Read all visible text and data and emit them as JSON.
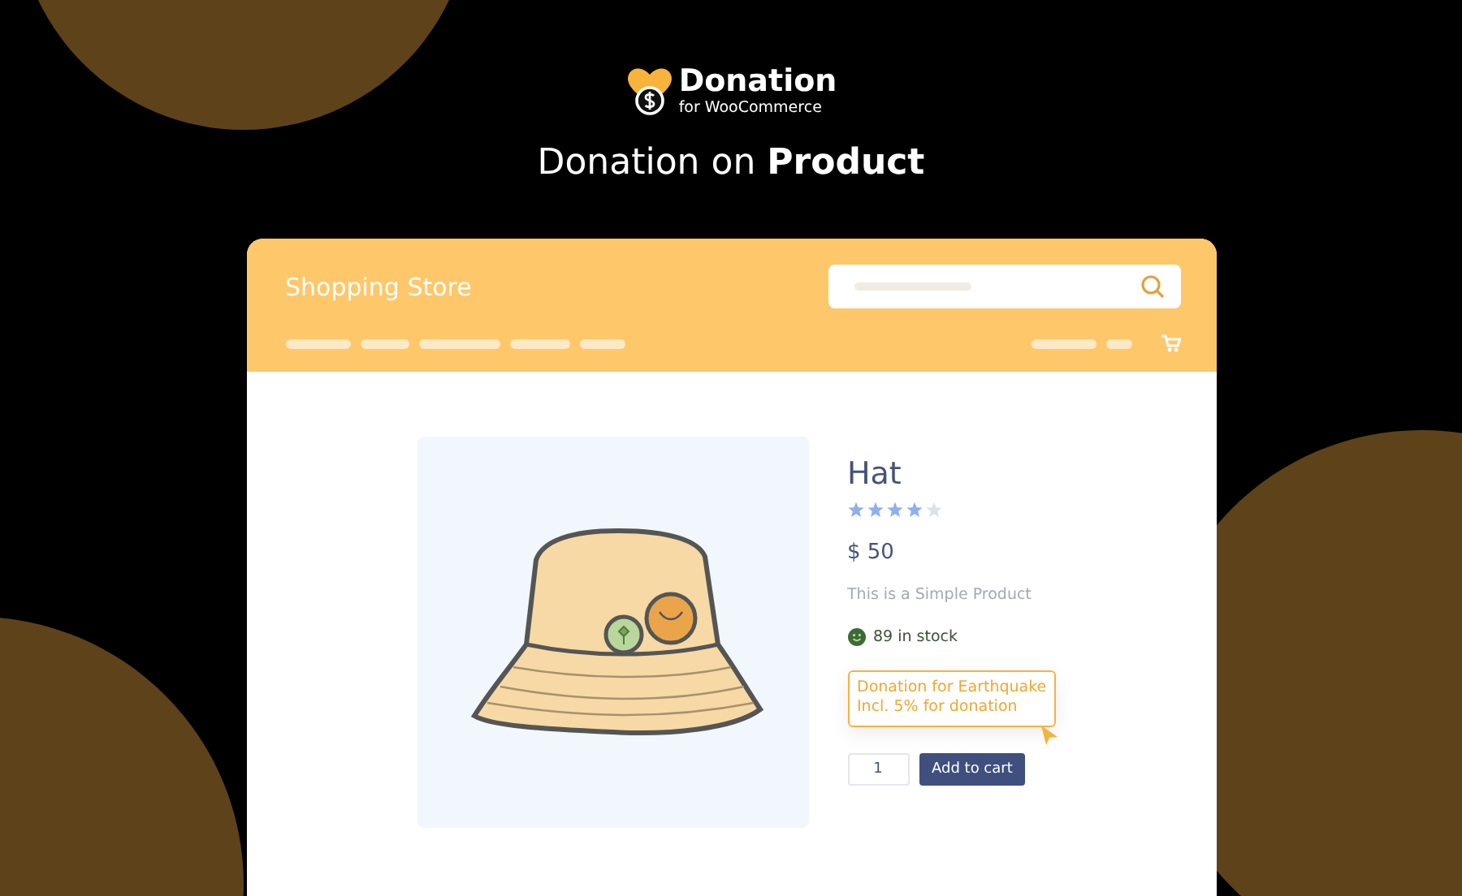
{
  "logo": {
    "name": "Donation",
    "tagline": "for WooCommerce"
  },
  "heading": "Donation on **Product**",
  "store": {
    "title": "Shopping Store"
  },
  "product": {
    "title": "Hat",
    "stars": 4,
    "price": "$ 50",
    "description": "This is a Simple Product",
    "stock": "89 in stock",
    "donation": {
      "title": "Donation for Earthquake",
      "note": "Incl. 5% for donation"
    },
    "quantity": "1",
    "add_button": "Add to cart"
  }
}
